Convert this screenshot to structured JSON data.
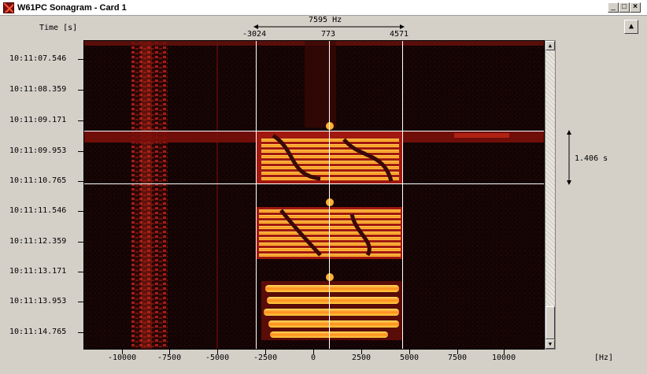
{
  "window": {
    "title": "W61PC Sonagram  - Card 1",
    "min_glyph": "_",
    "max_glyph": "□",
    "close_glyph": "×"
  },
  "header": {
    "time_label": "Time [s]",
    "bandwidth_label": "7595 Hz",
    "cursor_left": "-3024",
    "cursor_center": "773",
    "cursor_right": "4571"
  },
  "duration": {
    "label": "1.406 s"
  },
  "scroll_button": {
    "glyph": "▲"
  },
  "scrollbar": {
    "up_glyph": "▲",
    "down_glyph": "▼"
  },
  "y_axis": {
    "ticks": [
      "10:11:07.546",
      "10:11:08.359",
      "10:11:09.171",
      "10:11:09.953",
      "10:11:10.765",
      "10:11:11.546",
      "10:11:12.359",
      "10:11:13.171",
      "10:11:13.953",
      "10:11:14.765"
    ]
  },
  "x_axis": {
    "ticks": [
      "-10000",
      "-7500",
      "-5000",
      "-2500",
      "0",
      "2500",
      "5000",
      "7500",
      "10000"
    ],
    "unit": "[Hz]"
  },
  "colors": {
    "background": "#100505",
    "signal_hot": "#ffd84a",
    "signal_mid": "#ff7a1a",
    "signal_low": "#a01a10",
    "cursor": "#ffffff"
  }
}
